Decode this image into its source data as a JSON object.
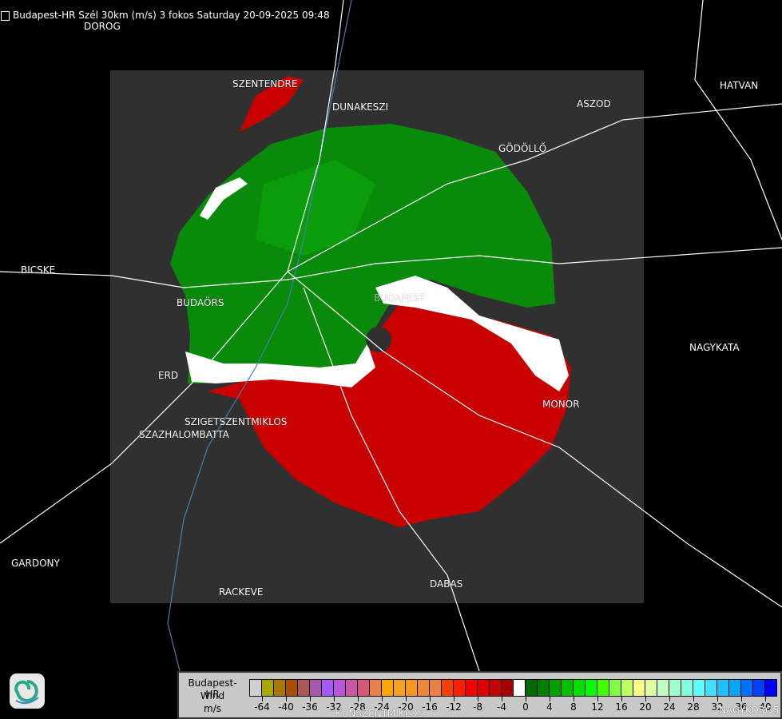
{
  "header": {
    "title": "Budapest-HR Szél 30km (m/s) 3 fokos Saturday 20-09-2025 09:48",
    "icon": "document-icon"
  },
  "places": [
    {
      "name": "DOROG"
    },
    {
      "name": "SZENTENDRE"
    },
    {
      "name": "DUNAKESZI"
    },
    {
      "name": "HATVAN"
    },
    {
      "name": "ASZOD"
    },
    {
      "name": "GÖDÖLLŐ"
    },
    {
      "name": "BICSKE"
    },
    {
      "name": "BUDAÖRS"
    },
    {
      "name": "BUDAPEST"
    },
    {
      "name": "NAGYKATA"
    },
    {
      "name": "ERD"
    },
    {
      "name": "MONOR"
    },
    {
      "name": "SZIGETSZENTMIKLOS"
    },
    {
      "name": "SZAZHALOMBATTA"
    },
    {
      "name": "GARDONY"
    },
    {
      "name": "RACKEVE"
    },
    {
      "name": "DABAS"
    },
    {
      "name": "KUNSZENTMIKLOS"
    },
    {
      "name": "NAGYKOROS"
    }
  ],
  "legend": {
    "station": "Budapest-HR",
    "quantity": "Wind",
    "unit": "m/s",
    "colors": [
      "#d0d0d0",
      "#a8a800",
      "#a87800",
      "#a85000",
      "#a85858",
      "#a858a8",
      "#a858f8",
      "#b858d8",
      "#c858a8",
      "#d85878",
      "#e88048",
      "#f8a800",
      "#f8a020",
      "#f89820",
      "#f08838",
      "#e88048",
      "#f84000",
      "#f82000",
      "#f80000",
      "#e00000",
      "#c80000",
      "#a80000",
      "#ffffff",
      "#006800",
      "#008000",
      "#00a000",
      "#00c000",
      "#00e000",
      "#00ff00",
      "#40ff00",
      "#80ff40",
      "#c0ff60",
      "#ffff80",
      "#e0ffa0",
      "#c0ffc0",
      "#a0ffd0",
      "#80ffe0",
      "#60ffff",
      "#40e0ff",
      "#20c0ff",
      "#00a8ff",
      "#0070ff",
      "#0040ff",
      "#0000ff"
    ],
    "ticks": [
      "-64",
      "-40",
      "-36",
      "-32",
      "-28",
      "-24",
      "-20",
      "-16",
      "-12",
      "-8",
      "-4",
      "0",
      "4",
      "8",
      "12",
      "16",
      "20",
      "24",
      "28",
      "32",
      "36",
      "40"
    ]
  },
  "colors": {
    "background": "#000000",
    "radar_domain": "#303030",
    "approaching": "#c80000",
    "receding": "#008000"
  },
  "logo": {
    "icon": "swirl-logo-icon"
  }
}
